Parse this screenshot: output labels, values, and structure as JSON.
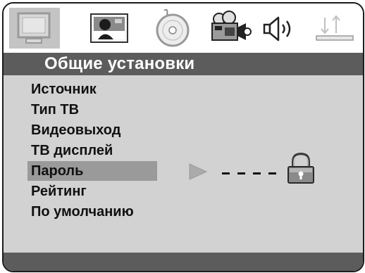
{
  "tabs": [
    {
      "name": "general-tab",
      "icon": "monitor-icon",
      "active": true
    },
    {
      "name": "picture-tab",
      "icon": "portrait-icon",
      "active": false
    },
    {
      "name": "disc-tab",
      "icon": "disc-icon",
      "active": false
    },
    {
      "name": "camera-tab",
      "icon": "camera-icon",
      "active": false
    },
    {
      "name": "audio-tab",
      "icon": "speaker-icon",
      "active": false
    },
    {
      "name": "exit-tab",
      "icon": "exit-icon",
      "active": false
    }
  ],
  "title": "Общие установки",
  "menu": {
    "items": [
      {
        "label": "Источник"
      },
      {
        "label": "Тип ТВ"
      },
      {
        "label": "Видеовыход"
      },
      {
        "label": "ТВ дисплей"
      },
      {
        "label": "Пароль",
        "selected": true
      },
      {
        "label": "Рейтинг"
      },
      {
        "label": "По умолчанию"
      }
    ]
  },
  "password": {
    "value": "----",
    "icons": [
      "arrow-right-icon",
      "lock-icon"
    ]
  },
  "colors": {
    "panel": "#d2d2d2",
    "title_bar": "#5c5c5c",
    "selection": "#9a9a9a",
    "border": "#1c1c1c"
  }
}
